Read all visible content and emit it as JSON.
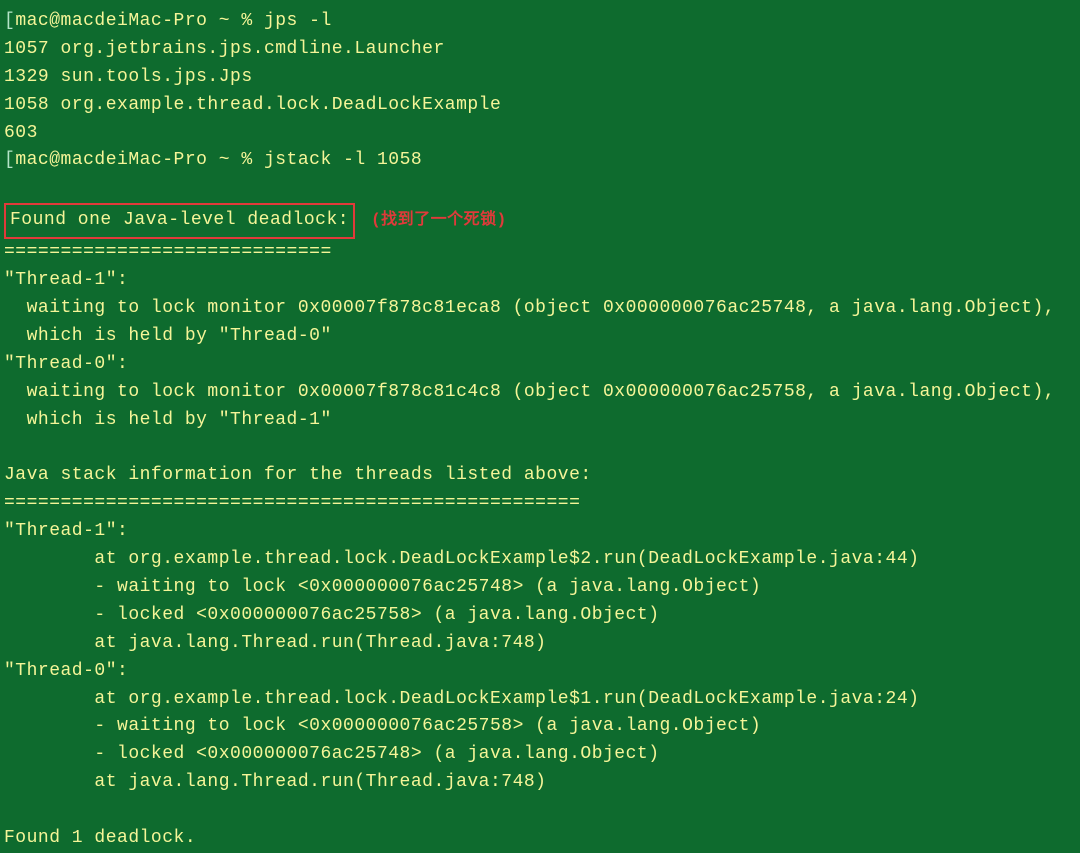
{
  "prompt_bracket": "[",
  "prompt_user_host": "mac@macdeiMac-Pro ~ % ",
  "commands": {
    "jps": "jps -l",
    "jstack": "jstack -l 1058"
  },
  "jps_output": [
    "1057 org.jetbrains.jps.cmdline.Launcher",
    "1329 sun.tools.jps.Jps",
    "1058 org.example.thread.lock.DeadLockExample",
    "603"
  ],
  "deadlock_header": "Found one Java-level deadlock:",
  "deadlock_annotation": "(找到了一个死锁)",
  "separator1": "=============================",
  "thread_summary": [
    "\"Thread-1\":",
    "  waiting to lock monitor 0x00007f878c81eca8 (object 0x000000076ac25748, a java.lang.Object),",
    "  which is held by \"Thread-0\"",
    "\"Thread-0\":",
    "  waiting to lock monitor 0x00007f878c81c4c8 (object 0x000000076ac25758, a java.lang.Object),",
    "  which is held by \"Thread-1\""
  ],
  "stack_info_header": "Java stack information for the threads listed above:",
  "separator2": "===================================================",
  "stack_traces": [
    "\"Thread-1\":",
    "        at org.example.thread.lock.DeadLockExample$2.run(DeadLockExample.java:44)",
    "        - waiting to lock <0x000000076ac25748> (a java.lang.Object)",
    "        - locked <0x000000076ac25758> (a java.lang.Object)",
    "        at java.lang.Thread.run(Thread.java:748)",
    "\"Thread-0\":",
    "        at org.example.thread.lock.DeadLockExample$1.run(DeadLockExample.java:24)",
    "        - waiting to lock <0x000000076ac25758> (a java.lang.Object)",
    "        - locked <0x000000076ac25748> (a java.lang.Object)",
    "        at java.lang.Thread.run(Thread.java:748)"
  ],
  "footer": "Found 1 deadlock."
}
